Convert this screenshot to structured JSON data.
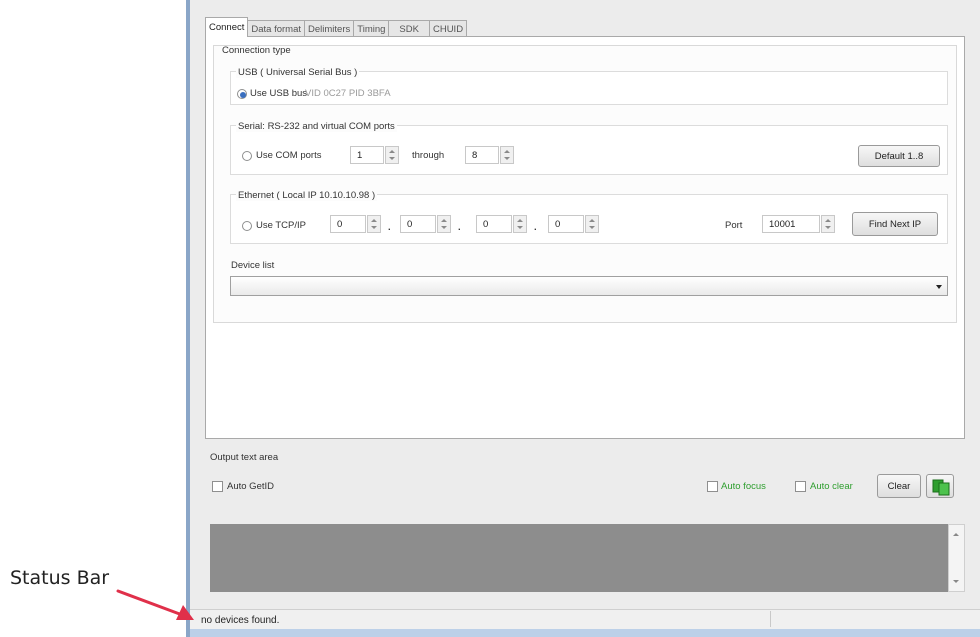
{
  "tabs": [
    "Connect",
    "Data format",
    "Delimiters",
    "Timing",
    "SDK",
    "CHUID"
  ],
  "connection": {
    "title": "Connection type",
    "usb": {
      "group_label": "USB ( Universal Serial Bus )",
      "option_label": "Use USB bus",
      "vid_pid": "VID 0C27  PID 3BFA"
    },
    "serial": {
      "group_label": "Serial: RS-232 and virtual COM ports",
      "option_label": "Use COM ports",
      "from": "1",
      "through_label": "through",
      "to": "8",
      "default_button": "Default 1..8"
    },
    "ethernet": {
      "group_label": "Ethernet ( Local IP 10.10.10.98 )",
      "option_label": "Use TCP/IP",
      "ip": [
        "0",
        "0",
        "0",
        "0"
      ],
      "dot": ".",
      "port_label": "Port",
      "port": "10001",
      "find_button": "Find Next IP"
    },
    "device_list": {
      "label": "Device list",
      "value": ""
    }
  },
  "output": {
    "label": "Output text area",
    "auto_getid": "Auto GetID",
    "auto_focus": "Auto focus",
    "auto_clear": "Auto clear",
    "clear_button": "Clear"
  },
  "status": {
    "message": "no devices found."
  },
  "annotation": {
    "label": "Status Bar"
  },
  "colors": {
    "accent_green": "#2e9e2e",
    "arrow_red": "#e0304a",
    "radio_selected": "#3a6fbf"
  },
  "icons": {
    "copy_output": "green-copy-icon"
  }
}
